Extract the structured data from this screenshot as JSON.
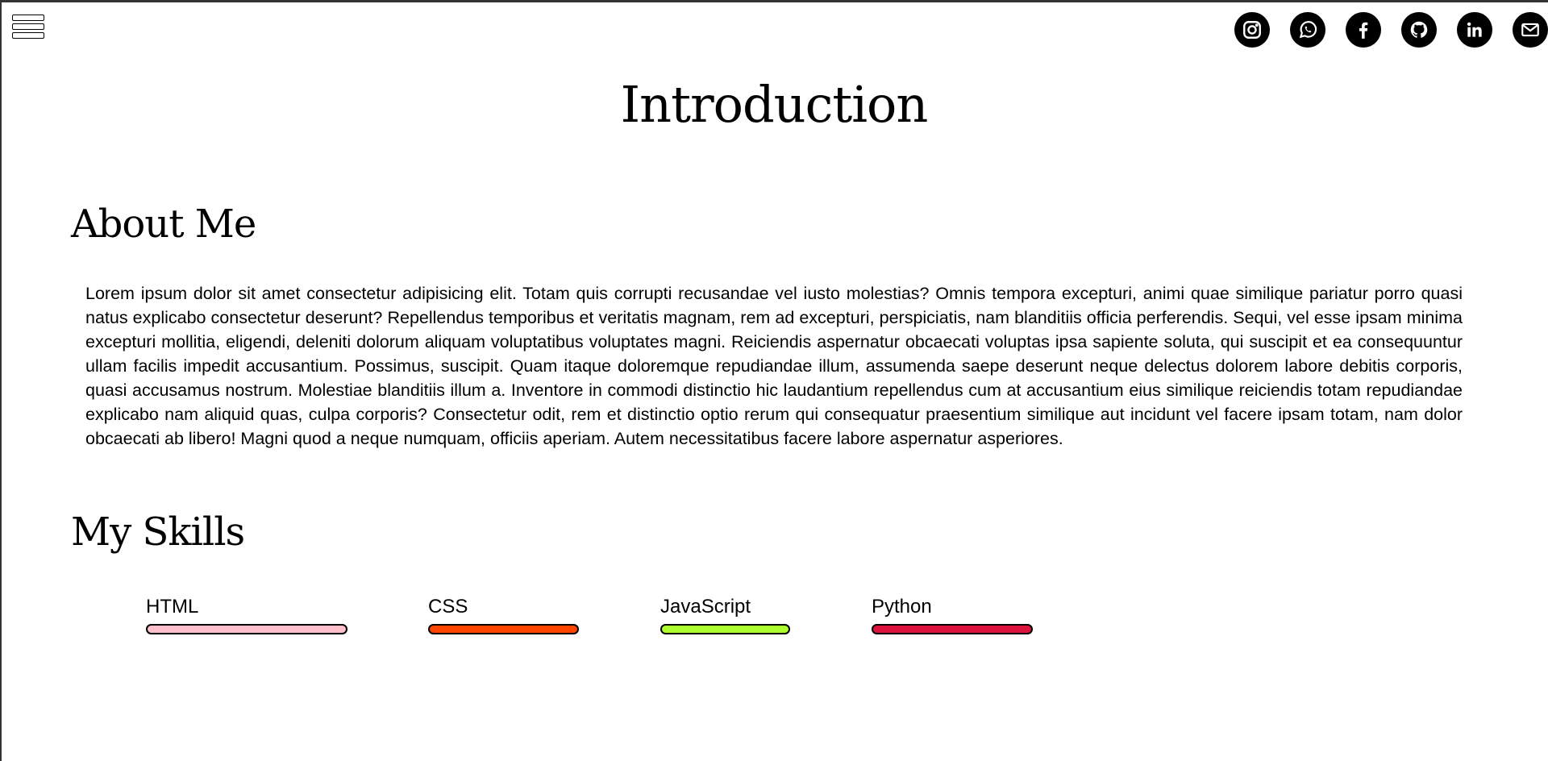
{
  "header": {
    "menu_icon": "hamburger-menu-icon",
    "socials": [
      {
        "name": "instagram",
        "icon": "instagram-icon"
      },
      {
        "name": "whatsapp",
        "icon": "whatsapp-icon"
      },
      {
        "name": "facebook",
        "icon": "facebook-icon"
      },
      {
        "name": "github",
        "icon": "github-icon"
      },
      {
        "name": "linkedin",
        "icon": "linkedin-icon"
      },
      {
        "name": "email",
        "icon": "mail-icon"
      }
    ]
  },
  "page": {
    "title": "Introduction"
  },
  "about": {
    "heading": "About Me",
    "text": "Lorem ipsum dolor sit amet consectetur adipisicing elit. Totam quis corrupti recusandae vel iusto molestias? Omnis tempora excepturi, animi quae similique pariatur porro quasi natus explicabo consectetur deserunt? Repellendus temporibus et veritatis magnam, rem ad excepturi, perspiciatis, nam blanditiis officia perferendis. Sequi, vel esse ipsam minima excepturi mollitia, eligendi, deleniti dolorum aliquam voluptatibus voluptates magni. Reiciendis aspernatur obcaecati voluptas ipsa sapiente soluta, qui suscipit et ea consequuntur ullam facilis impedit accusantium. Possimus, suscipit. Quam itaque doloremque repudiandae illum, assumenda saepe deserunt neque delectus dolorem labore debitis corporis, quasi accusamus nostrum. Molestiae blanditiis illum a. Inventore in commodi distinctio hic laudantium repellendus cum at accusantium eius similique reiciendis totam repudiandae explicabo nam aliquid quas, culpa corporis? Consectetur odit, rem et distinctio optio rerum qui consequatur praesentium similique aut incidunt vel facere ipsam totam, nam dolor obcaecati ab libero! Magni quod a neque numquam, officiis aperiam. Autem necessitatibus facere labore aspernatur asperiores."
  },
  "skills": {
    "heading": "My Skills",
    "items": [
      {
        "label": "HTML",
        "color": "#ffc0cb"
      },
      {
        "label": "CSS",
        "color": "#ff4500"
      },
      {
        "label": "JavaScript",
        "color": "#adff2f"
      },
      {
        "label": "Python",
        "color": "#dc143c"
      }
    ]
  }
}
